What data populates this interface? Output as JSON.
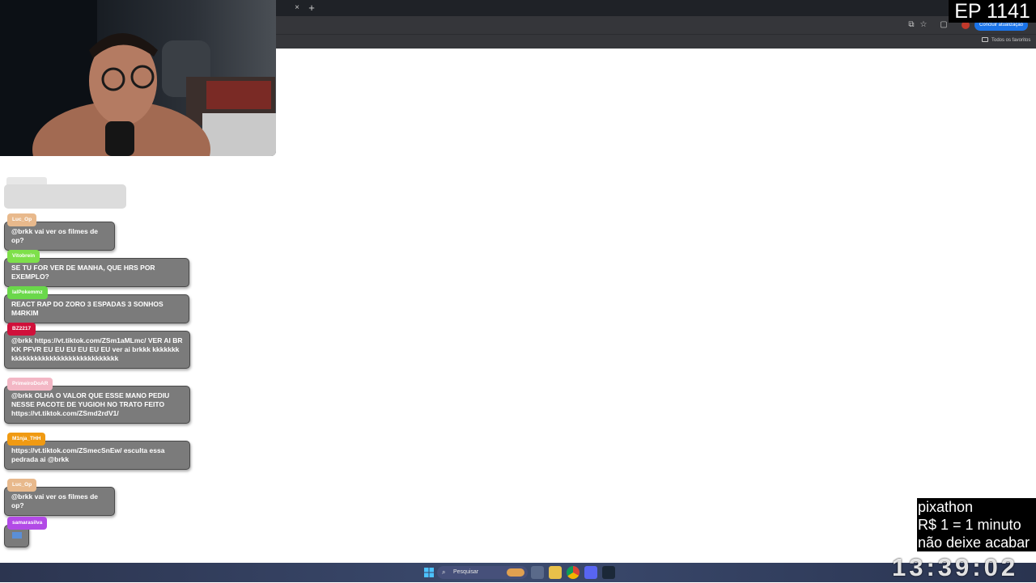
{
  "overlay": {
    "episode": "EP 1141",
    "pixathon": [
      "pixathon",
      "R$ 1 = 1 minuto",
      "não deixe acabar"
    ],
    "timer": "13:39:02"
  },
  "browser": {
    "tab_close": "×",
    "tab_new": "+",
    "update_button": "Concluir atualização",
    "bookmarks_all": "Todos os favoritos"
  },
  "chat": [
    {
      "user": "Luc_Op",
      "color": "#e8b98c",
      "text": "@brkk vai ver os filmes de op?"
    },
    {
      "user": "Vitobrein",
      "color": "#7ee04a",
      "text": "SE TU FOR VER DE MANHA, QUE HRS POR EXEMPLO?"
    },
    {
      "user": "lalPokemmz",
      "color": "#6ad84a",
      "text": "REACT RAP DO ZORO 3 ESPADAS 3 SONHOS M4RKIM"
    },
    {
      "user": "BZ2217",
      "color": "#d0103a",
      "text": "@brkk https://vt.tiktok.com/ZSm1aMLmc/ VER AI BRKK PFVR EU EU EU EU EU EU ver ai brkkk kkkkkkkkkkkkkkkkkkkkkkkkkkkkkkkkkkk"
    },
    {
      "user": "PrimeiroDoAR",
      "color": "#f3b7c5",
      "text": "@brkk OLHA O VALOR QUE ESSE MANO PEDIU NESSE PACOTE DE YUGIOH NO TRATO FEITO https://vt.tiktok.com/ZSmd2rdV1/"
    },
    {
      "user": "M1nja_THH",
      "color": "#f09a12",
      "text": "https://vt.tiktok.com/ZSmecSnEw/ esculta essa pedrada ai @brkk"
    },
    {
      "user": "Luc_Op",
      "color": "#e8b98c",
      "text": "@brkk vai ver os filmes de op?"
    },
    {
      "user": "samarasilva",
      "color": "#b24ae6",
      "text": ""
    }
  ],
  "taskbar": {
    "search_placeholder": "Pesquisar"
  },
  "colors": {
    "taskbar": "#34405f",
    "chat_bubble": "#7b7b7b",
    "accent": "#1a73e8"
  },
  "icons": [
    "windows-start-icon",
    "search-icon",
    "task-view-icon",
    "file-explorer-icon",
    "chrome-icon",
    "discord-icon",
    "steam-icon",
    "star-icon",
    "translate-icon"
  ]
}
